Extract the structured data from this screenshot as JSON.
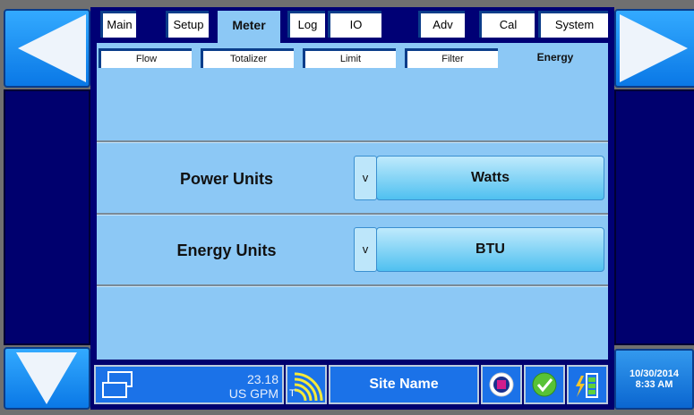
{
  "tabs": [
    {
      "label": "Main"
    },
    {
      "label": "Setup"
    },
    {
      "label": "Meter"
    },
    {
      "label": "Log"
    },
    {
      "label": "IO"
    },
    {
      "label": "Adv"
    },
    {
      "label": "Cal"
    },
    {
      "label": "System"
    }
  ],
  "active_tab": "Meter",
  "subtabs": [
    {
      "label": "Flow"
    },
    {
      "label": "Totalizer"
    },
    {
      "label": "Limit"
    },
    {
      "label": "Filter"
    },
    {
      "label": "Energy"
    }
  ],
  "active_subtab": "Energy",
  "settings": {
    "power": {
      "label": "Power Units",
      "arrow": "v",
      "value": "Watts"
    },
    "energy": {
      "label": "Energy Units",
      "arrow": "v",
      "value": "BTU"
    }
  },
  "status": {
    "rate_value": "23.18",
    "rate_unit": "US GPM",
    "signal_label": "T",
    "site_name": "Site Name",
    "date": "10/30/2014",
    "time": "8:33 AM"
  },
  "colors": {
    "panel": "#8cc8f5",
    "navy": "#00006e",
    "accent": "#1b72e8"
  }
}
